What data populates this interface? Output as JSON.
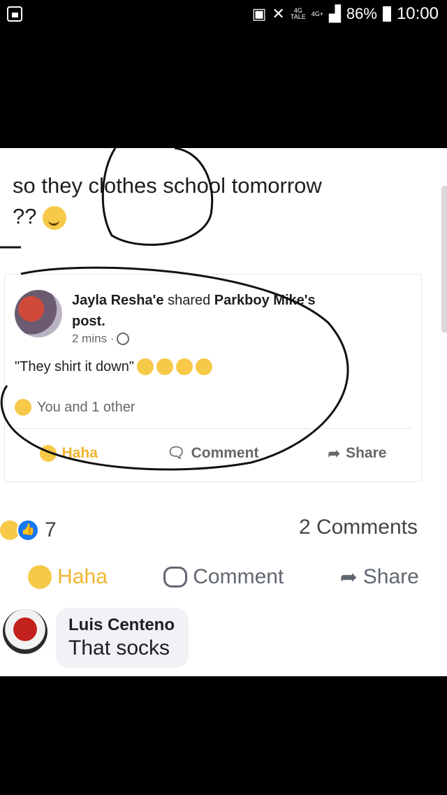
{
  "status_bar": {
    "network_top": "4G",
    "network_bottom": "TALE",
    "network2": "4G+",
    "battery": "86%",
    "time": "10:00"
  },
  "post": {
    "text_part1": "so they clothes school tomorrow",
    "text_part2": "??",
    "shared_card": {
      "sharer": "Jayla Resha'e",
      "shared_text": "shared",
      "original_author": "Parkboy Mike's",
      "post_word": "post.",
      "time": "2 mins ·",
      "quote": "\"They shirt it down\"",
      "reactors": "You and 1 other",
      "actions": {
        "haha": "Haha",
        "comment": "Comment",
        "share": "Share"
      }
    },
    "reaction_count": "7",
    "comments_count": "2 Comments",
    "actions": {
      "haha": "Haha",
      "comment": "Comment",
      "share": "Share"
    }
  },
  "comment": {
    "author": "Luis Centeno",
    "text": "That socks"
  }
}
